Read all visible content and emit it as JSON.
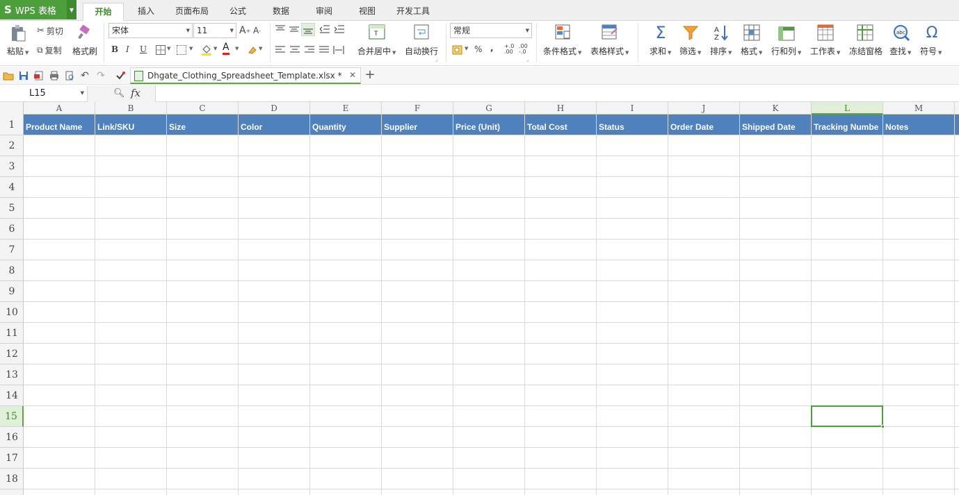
{
  "app": {
    "logo": "S",
    "name": "WPS 表格"
  },
  "ribbon_tabs": [
    {
      "label": "开始",
      "active": true
    },
    {
      "label": "插入",
      "active": false
    },
    {
      "label": "页面布局",
      "active": false
    },
    {
      "label": "公式",
      "active": false
    },
    {
      "label": "数据",
      "active": false
    },
    {
      "label": "审阅",
      "active": false
    },
    {
      "label": "视图",
      "active": false
    },
    {
      "label": "开发工具",
      "active": false
    }
  ],
  "ribbon": {
    "paste": "粘贴",
    "cut": "剪切",
    "copy": "复制",
    "format_painter": "格式刷",
    "font_name": "宋体",
    "font_size": "11",
    "merge_center": "合并居中",
    "wrap_text": "自动换行",
    "number_format": "常规",
    "percent": "%",
    "comma": ",",
    "conditional_format": "条件格式",
    "table_style": "表格样式",
    "sum": "求和",
    "filter": "筛选",
    "sort": "排序",
    "format": "格式",
    "rows_cols": "行和列",
    "worksheet": "工作表",
    "freeze": "冻结窗格",
    "find": "查找",
    "symbol": "符号",
    "bold": "B",
    "italic": "I",
    "underline": "U",
    "font_color_letter": "A"
  },
  "document": {
    "filename": "Dhgate_Clothing_Spreadsheet_Template.xlsx *"
  },
  "formula_bar": {
    "name_box": "L15",
    "fx": "fx",
    "value": ""
  },
  "columns": [
    "A",
    "B",
    "C",
    "D",
    "E",
    "F",
    "G",
    "H",
    "I",
    "J",
    "K",
    "L",
    "M"
  ],
  "rows": [
    "1",
    "2",
    "3",
    "4",
    "5",
    "6",
    "7",
    "8",
    "9",
    "10",
    "11",
    "12",
    "13",
    "14",
    "15",
    "16",
    "17",
    "18"
  ],
  "selected_cell": {
    "column": "L",
    "row": "15"
  },
  "header_row": [
    "Product Name",
    "Link/SKU",
    "Size",
    "Color",
    "Quantity",
    "Supplier",
    "Price (Unit)",
    "Total Cost",
    "Status",
    "Order Date",
    "Shipped Date",
    "Tracking Numbe",
    "Notes"
  ],
  "colors": {
    "brand": "#4c9e3a",
    "header_fill": "#4f81bd",
    "header_text": "#ffffff"
  }
}
